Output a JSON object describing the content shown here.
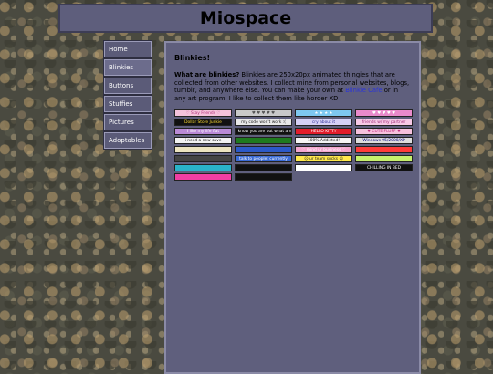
{
  "site": {
    "title": "Miospace"
  },
  "nav": [
    {
      "label": "Home",
      "name": "nav-home"
    },
    {
      "label": "Blinkies",
      "name": "nav-blinkies",
      "active": true
    },
    {
      "label": "Buttons",
      "name": "nav-buttons"
    },
    {
      "label": "Stuffies",
      "name": "nav-stuffies"
    },
    {
      "label": "Pictures",
      "name": "nav-pictures"
    },
    {
      "label": "Adoptables",
      "name": "nav-adoptables"
    }
  ],
  "main": {
    "heading": "Blinkies!",
    "question": "What are blinkies?",
    "text1": " Blinkies are 250x20px animated thingies that are collected from other websites. I collect mine from personal websites, blogs, tumblr, and anywhere else. You can make your own at ",
    "link_text": "Blinkie Cafe",
    "text2": " or in any art program. I like to collect them like horder XD"
  },
  "blinkies": [
    {
      "text": "♡ Stay Friends ♡",
      "bg": "#f4c2dc",
      "fg": "#b0307a"
    },
    {
      "text": "♥ ♥ ♥ ♥ ♥",
      "bg": "#c9c9c9",
      "fg": "#555555"
    },
    {
      "text": "★ ★ ★ ★",
      "bg": "#7ec8f0",
      "fg": "#ffffff"
    },
    {
      "text": "♥ ♥ ♥ ♥ ♥",
      "bg": "#e98acb",
      "fg": "#ffffff"
    },
    {
      "text": "Dollar Store Junkie",
      "bg": "#111111",
      "fg": "#ffdd33"
    },
    {
      "text": "my code won't work :(",
      "bg": "#e8e8e8",
      "fg": "#222222"
    },
    {
      "text": "cry about it",
      "bg": "#d6d0f5",
      "fg": "#333399"
    },
    {
      "text": "friends w/ my partner",
      "bg": "#f7c9e6",
      "fg": "#a0307a"
    },
    {
      "text": "I like my life flat",
      "bg": "#b98ad6",
      "fg": "#ffffff"
    },
    {
      "text": "i know you are but what am i?",
      "bg": "#111111",
      "fg": "#ffffff"
    },
    {
      "text": "HELLO KITTY",
      "bg": "#e21d2b",
      "fg": "#ffffff"
    },
    {
      "text": "♥ CUTE FLUFF ♥",
      "bg": "#f6c1dd",
      "fg": "#c0307f"
    },
    {
      "text": "i need a new save",
      "bg": "#f2f2f2",
      "fg": "#111111"
    },
    {
      "text": "",
      "bg": "#1f7a1f",
      "fg": "#ffffff"
    },
    {
      "text": "100% Addicted!",
      "bg": "#f5f5f5",
      "fg": "#111111"
    },
    {
      "text": "Windows 95/2000/XP",
      "bg": "#dddddd",
      "fg": "#000080"
    },
    {
      "text": "",
      "bg": "#ede4c0",
      "fg": "#333333"
    },
    {
      "text": "",
      "bg": "#2b59c9",
      "fg": "#ffffff"
    },
    {
      "text": "♡ mind ur business ♡",
      "bg": "#f4a6cf",
      "fg": "#ffffff"
    },
    {
      "text": "",
      "bg": "#ff3b3b",
      "fg": "#ffffff"
    },
    {
      "text": "",
      "bg": "#444444",
      "fg": "#ffffff"
    },
    {
      "text": "talk to people: currently",
      "bg": "#3a6bd6",
      "fg": "#ffffff"
    },
    {
      "text": "☹ ur team sucks ☹",
      "bg": "#ffe94d",
      "fg": "#222222"
    },
    {
      "text": "",
      "bg": "#c6f06b",
      "fg": "#333333"
    },
    {
      "text": "",
      "bg": "#2ab3c9",
      "fg": "#ffffff"
    },
    {
      "text": "",
      "bg": "#111111",
      "fg": "#ffffff"
    },
    {
      "text": "",
      "bg": "#ffffff",
      "fg": "#000000"
    },
    {
      "text": "CHILLING IN BED",
      "bg": "#111111",
      "fg": "#ffffff"
    },
    {
      "text": "",
      "bg": "#f03ea3",
      "fg": "#ffffff"
    },
    {
      "text": "",
      "bg": "#111111",
      "fg": "#ffffff"
    },
    {
      "text": "",
      "bg": "",
      "fg": ""
    },
    {
      "text": "",
      "bg": "",
      "fg": ""
    }
  ]
}
